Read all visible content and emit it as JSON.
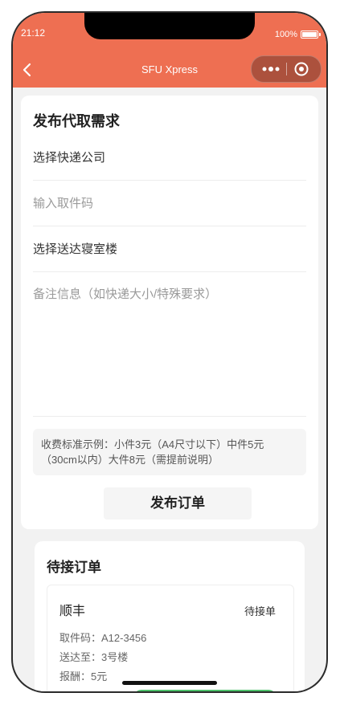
{
  "status_bar": {
    "time": "21:12",
    "battery": "100%"
  },
  "nav": {
    "title": "SFU Xpress"
  },
  "publish_card": {
    "title": "发布代取需求",
    "courier_select": "选择快递公司",
    "pickup_code_placeholder": "输入取件码",
    "dorm_select": "选择送达寝室楼",
    "remark_placeholder": "备注信息（如快递大小/特殊要求）",
    "fee_note": "收费标准示例：小件3元（A4尺寸以下）中件5元（30cm以内）大件8元（需提前说明）",
    "publish_button": "发布订单"
  },
  "pending_card": {
    "title": "待接订单",
    "orders": [
      {
        "courier": "顺丰",
        "status": "待接单",
        "pickup_code": "取件码：A12-3456",
        "deliver_to": "送达至：3号楼",
        "reward": "报酬：5元"
      }
    ]
  },
  "colors": {
    "accent": "#ee6f52",
    "success": "#4cc16a"
  }
}
